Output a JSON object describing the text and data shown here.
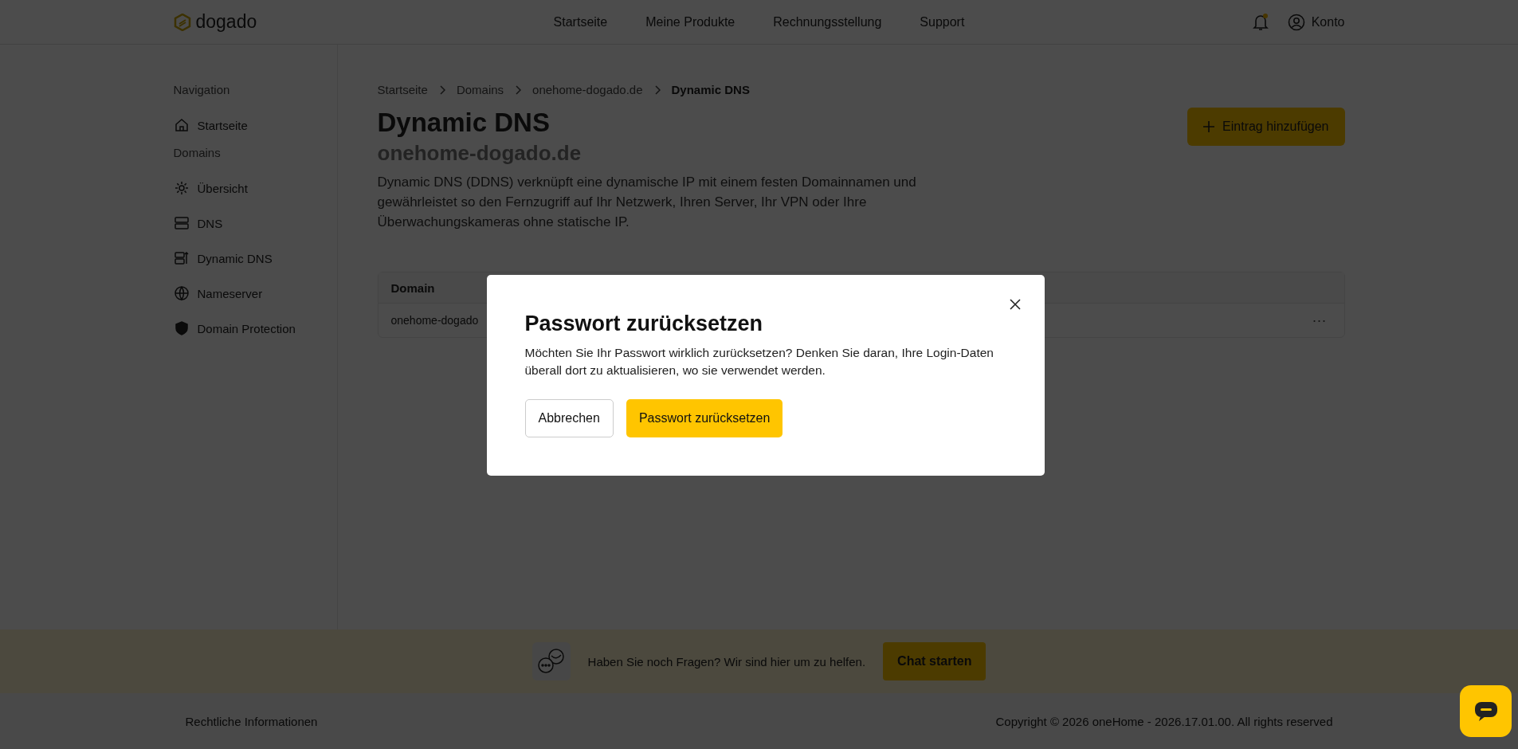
{
  "header": {
    "logo": "dogado",
    "nav": [
      "Startseite",
      "Meine Produkte",
      "Rechnungsstellung",
      "Support"
    ],
    "notification_dot": true,
    "account": "Konto"
  },
  "sidebar": {
    "sections": [
      {
        "title": "Navigation",
        "items": [
          {
            "label": "Startseite"
          }
        ]
      },
      {
        "title": "Domains",
        "items": [
          {
            "label": "Übersicht"
          },
          {
            "label": "DNS"
          },
          {
            "label": "Dynamic DNS"
          },
          {
            "label": "Nameserver"
          },
          {
            "label": "Domain Protection"
          }
        ]
      }
    ]
  },
  "breadcrumb": [
    "Startseite",
    "Domains",
    "onehome-dogado.de",
    "Dynamic DNS"
  ],
  "page": {
    "title": "Dynamic DNS",
    "subtitle": "onehome-dogado.de",
    "description": "Dynamic DNS (DDNS) verknüpft eine dynamische IP mit einem festen Domainnamen und gewährleistet so den Fernzugriff auf Ihr Netzwerk, Ihren Server, Ihr VPN oder Ihre Überwachungskameras ohne statische IP.",
    "add_button": "Eintrag hinzufügen"
  },
  "table": {
    "columns": [
      "Domain"
    ],
    "rows": [
      {
        "cells": [
          "onehome-dogado"
        ],
        "menu": "···"
      }
    ]
  },
  "help_bar": {
    "text": "Haben Sie noch Fragen? Wir sind hier um zu helfen.",
    "button": "Chat starten"
  },
  "footer": {
    "link": "Rechtliche Informationen",
    "copyright": "Copyright © 2026 oneHome - 2026.17.01.00. All rights reserved"
  },
  "modal": {
    "title": "Passwort zurücksetzen",
    "text": "Möchten Sie Ihr Passwort wirklich zurücksetzen? Denken Sie daran, Ihre Login-Daten überall dort zu aktualisieren, wo sie verwendet werden.",
    "buttons": [
      {
        "label": "Abbrechen",
        "kind": "secondary"
      },
      {
        "label": "Passwort zurücksetzen",
        "kind": "primary"
      }
    ]
  }
}
